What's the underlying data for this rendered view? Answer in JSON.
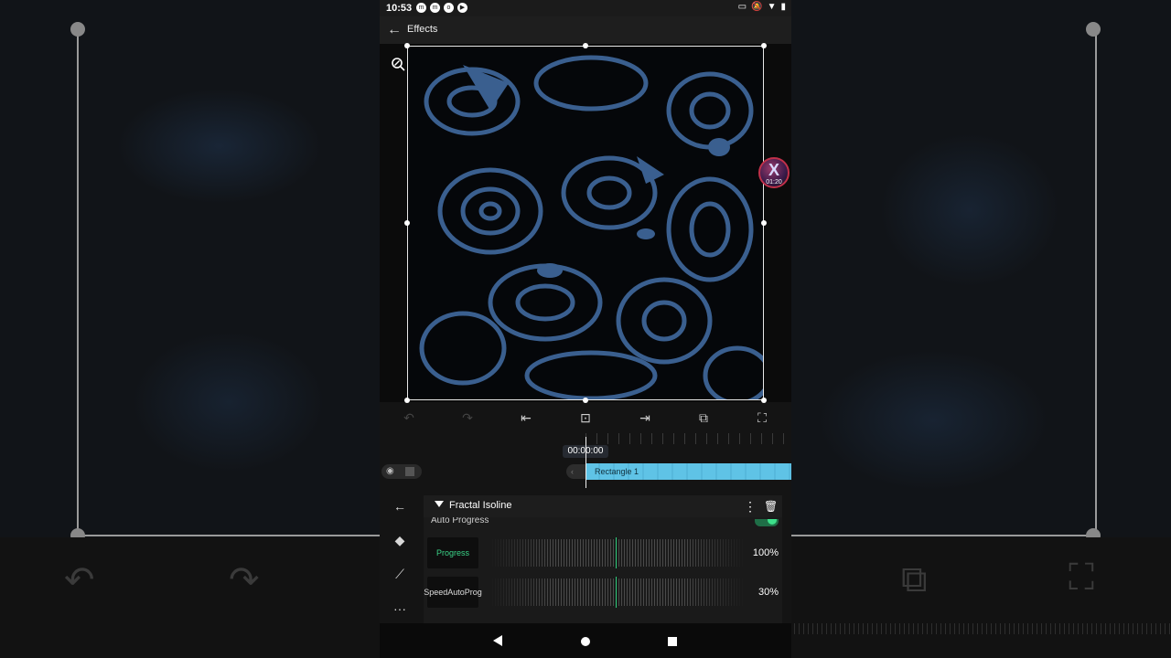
{
  "status_bar": {
    "time": "10:53",
    "app_icons": [
      "m",
      "m",
      "o",
      "play"
    ],
    "right_icons": [
      "cast-icon",
      "mute-icon",
      "wifi-icon",
      "battery-icon"
    ]
  },
  "app_bar": {
    "title": "Effects"
  },
  "floating_badge": {
    "letter": "X",
    "time": "01:20"
  },
  "toolbar": {
    "icons": [
      "undo-icon",
      "redo-icon",
      "jump-to-start-icon",
      "play-preview-icon",
      "jump-to-end-icon",
      "duplicate-icon",
      "fullscreen-icon"
    ]
  },
  "timeline": {
    "timecode": "00:00:00",
    "clip_label": "Rectangle 1"
  },
  "effect": {
    "name": "Fractal Isoline",
    "auto_progress_label": "Auto Progress",
    "auto_progress_on": true,
    "params": [
      {
        "label": "Progress",
        "value": "100%",
        "active": true
      },
      {
        "label_line1": "Speed",
        "label_line2": "AutoProg",
        "value": "30%",
        "active": false
      }
    ]
  },
  "colors": {
    "accent": "#3ad488",
    "clip": "#5fc3e6",
    "pattern_line": "#3a5f8f"
  }
}
